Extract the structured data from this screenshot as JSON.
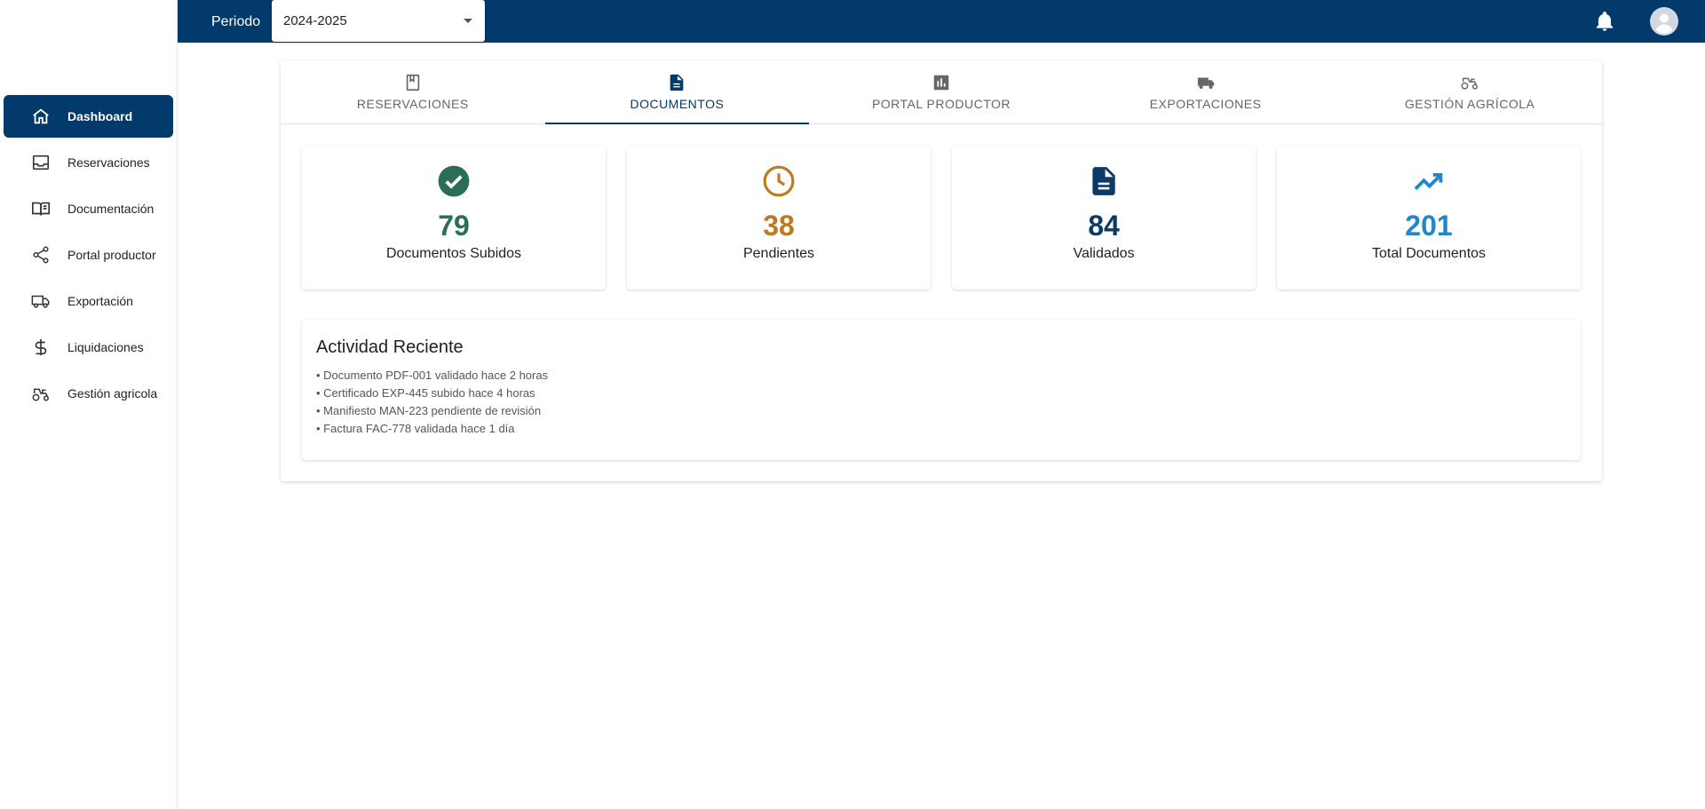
{
  "sidebar": {
    "items": [
      {
        "label": "Dashboard",
        "icon": "home-icon"
      },
      {
        "label": "Reservaciones",
        "icon": "inbox-icon"
      },
      {
        "label": "Documentación",
        "icon": "book-open-icon"
      },
      {
        "label": "Portal productor",
        "icon": "share-icon"
      },
      {
        "label": "Exportación",
        "icon": "truck-icon"
      },
      {
        "label": "Liquidaciones",
        "icon": "dollar-icon"
      },
      {
        "label": "Gestión agricola",
        "icon": "tractor-icon"
      }
    ]
  },
  "topbar": {
    "periodo_label": "Periodo",
    "periodo_value": "2024-2025"
  },
  "tabs": [
    {
      "label": "RESERVACIONES",
      "icon": "bookmark-icon"
    },
    {
      "label": "DOCUMENTOS",
      "icon": "document-icon"
    },
    {
      "label": "PORTAL PRODUCTOR",
      "icon": "bar-chart-icon"
    },
    {
      "label": "EXPORTACIONES",
      "icon": "truck-icon"
    },
    {
      "label": "GESTIÓN AGRÍCOLA",
      "icon": "tractor-icon"
    }
  ],
  "stats": [
    {
      "value": "79",
      "label": "Documentos Subidos",
      "icon": "check-circle-icon",
      "color": "#2a6e57"
    },
    {
      "value": "38",
      "label": "Pendientes",
      "icon": "clock-icon",
      "color": "#bf7a1f"
    },
    {
      "value": "84",
      "label": "Validados",
      "icon": "document-icon",
      "color": "#0b3a69"
    },
    {
      "value": "201",
      "label": "Total Documentos",
      "icon": "trending-up-icon",
      "color": "#1e88c9"
    }
  ],
  "activity": {
    "title": "Actividad Reciente",
    "items": [
      "• Documento PDF-001 validado hace 2 horas",
      "• Certificado EXP-445 subido hace 4 horas",
      "• Manifiesto MAN-223 pendiente de revisión",
      "• Factura FAC-778 validada hace 1 día"
    ]
  },
  "colors": {
    "brand": "#023a6b",
    "tab_inactive": "#666666"
  }
}
